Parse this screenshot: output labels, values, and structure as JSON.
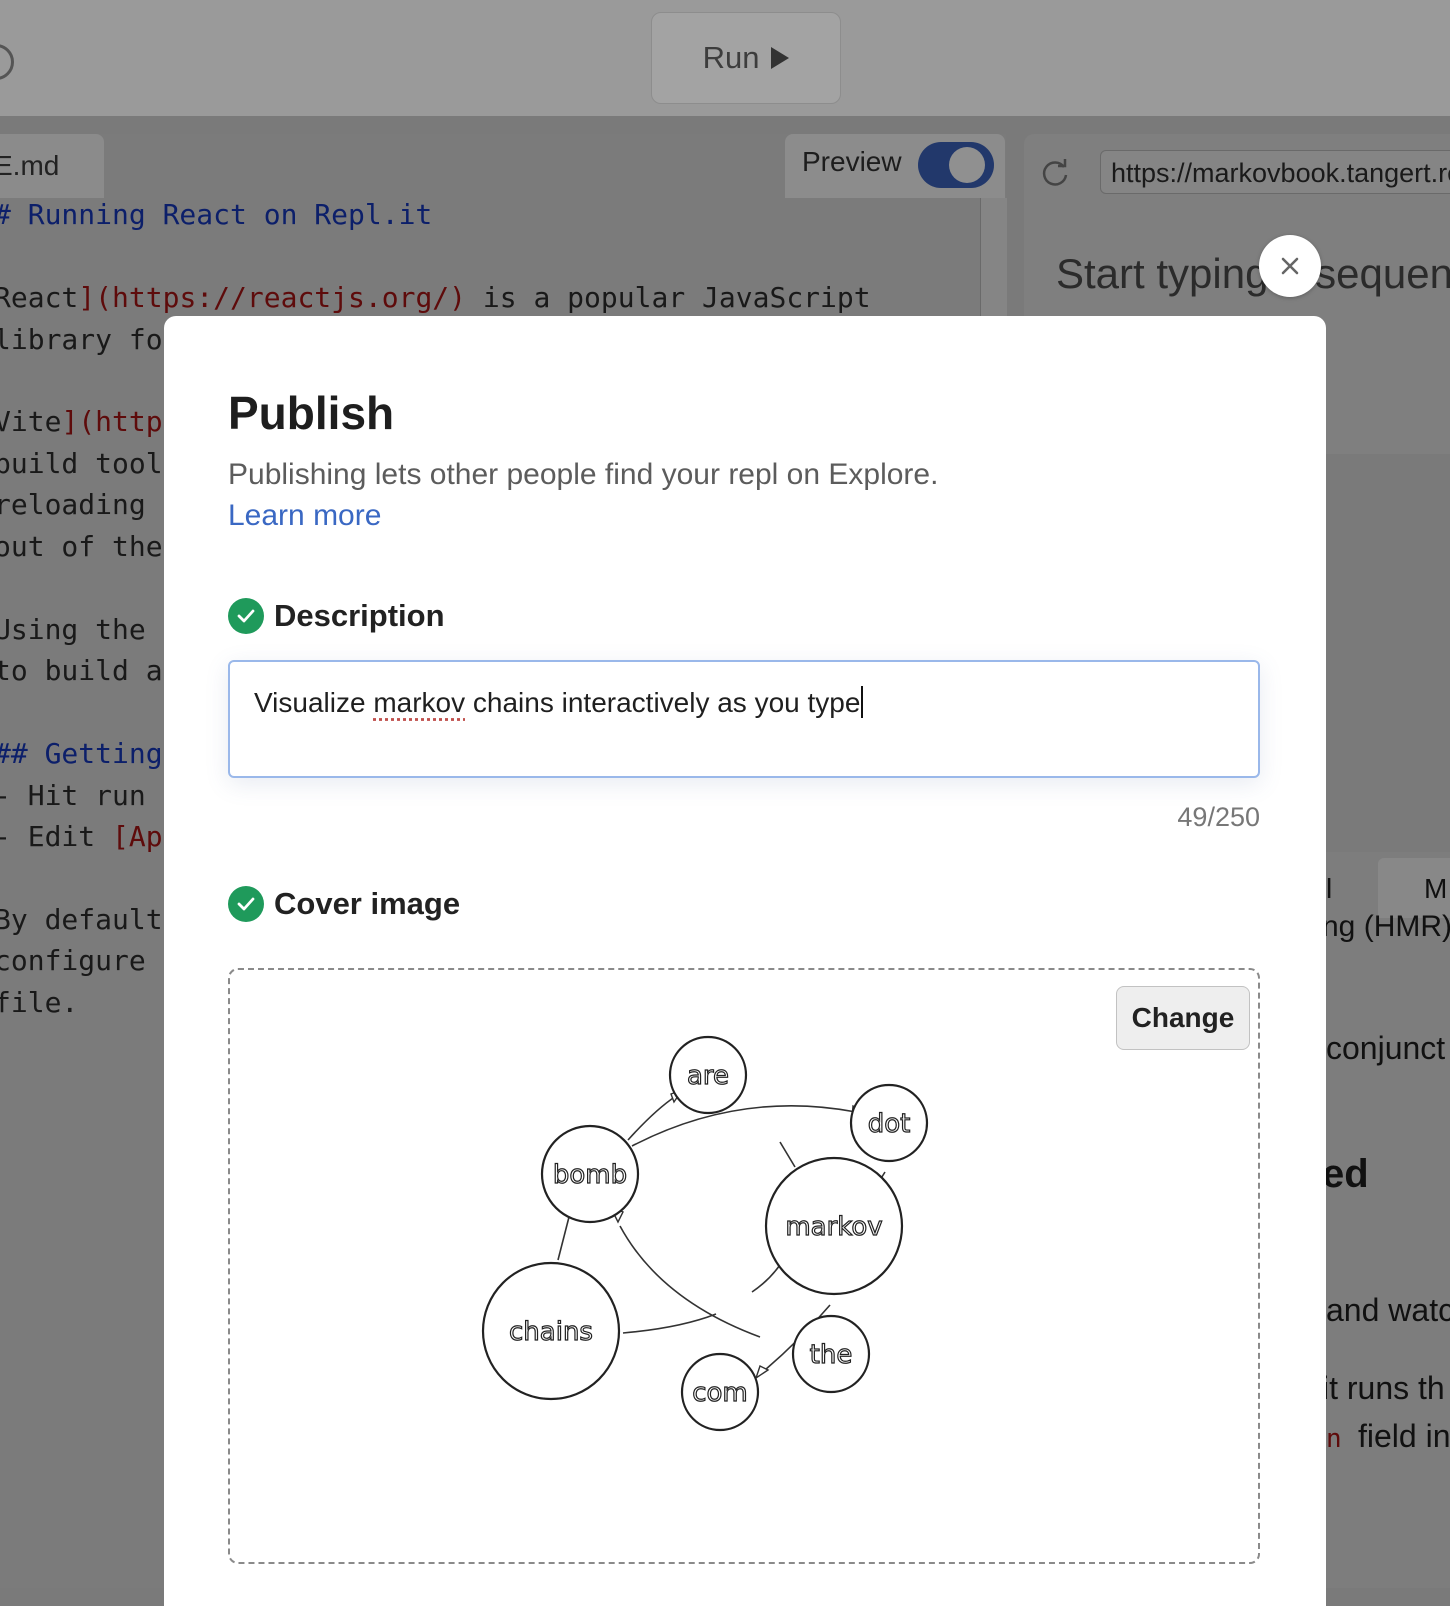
{
  "toolbar": {
    "run_label": "Run"
  },
  "editor": {
    "tab_label": "E.md",
    "preview_label": "Preview",
    "preview_enabled": true,
    "lines": [
      {
        "heading": "# Running React on Repl.it"
      },
      {
        "t1": "React",
        "link": "](https://reactjs.org/)",
        "t2": " is a popular JavaScript"
      },
      {
        "text": "library fo"
      },
      {
        "t1": "Vite",
        "link": "](http"
      },
      {
        "text": "build tool"
      },
      {
        "text": "reloading ("
      },
      {
        "text": "out of the"
      },
      {
        "text": "Using the t"
      },
      {
        "text": "to build a"
      },
      {
        "heading": "## Getting"
      },
      {
        "text": "- Hit run"
      },
      {
        "t1": "- Edit ",
        "link": "[App"
      },
      {
        "text": "By default,"
      },
      {
        "text": "configure i"
      },
      {
        "text": "file."
      }
    ]
  },
  "webview": {
    "url": "https://markovbook.tangert.repl.co",
    "placeholder": "Start typing a sequence",
    "doc_fragments": {
      "tab_left": "l",
      "tab_right": "M",
      "hmr": "ng (HMR)",
      "conjunct": "conjunct",
      "heading": "ed",
      "watch": "and watc",
      "runs": "it runs th",
      "code": "n",
      "field": "field in"
    }
  },
  "modal": {
    "close_icon": "close-icon",
    "title": "Publish",
    "description": "Publishing lets other people find your repl on Explore.",
    "learn_more": "Learn more",
    "description_section": {
      "title": "Description",
      "value_before": "Visualize ",
      "value_misspelled": "markov",
      "value_after": " chains interactively as you type",
      "counter": "49/250"
    },
    "cover_section": {
      "title": "Cover image",
      "change_label": "Change",
      "graph_nodes": [
        "are",
        "dot",
        "bomb",
        "markov",
        "chains",
        "the",
        "com"
      ]
    }
  },
  "colors": {
    "accent_link": "#3a68c3",
    "success": "#1f9a5b",
    "input_focus": "#9ab8ea"
  }
}
